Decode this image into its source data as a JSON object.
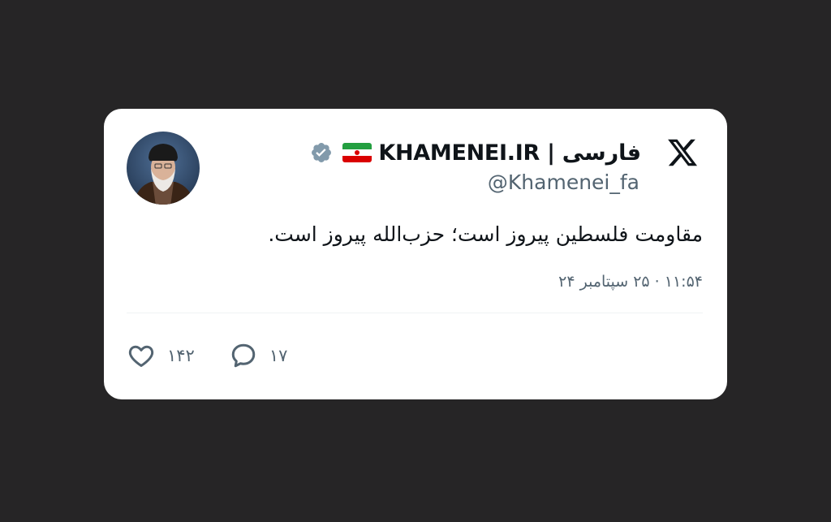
{
  "tweet": {
    "display_name": "KHAMENEI.IR | فارسی",
    "flag_icon": "iran-flag-icon",
    "verified_icon": "verified-badge-icon",
    "handle": "@Khamenei_fa",
    "text": "مقاومت فلسطین پیروز است؛ حزب‌الله پیروز است.",
    "timestamp": "۱۱:۵۴ · ۲۵ سپتامبر ۲۴",
    "likes": "۱۴۲",
    "replies": "۱۷"
  },
  "icons": {
    "platform": "x-logo-icon",
    "like": "heart-icon",
    "reply": "comment-bubble-icon"
  },
  "colors": {
    "background": "#262526",
    "card": "#ffffff",
    "text_primary": "#0f1419",
    "text_secondary": "#536471",
    "verified_badge": "#829aab"
  }
}
